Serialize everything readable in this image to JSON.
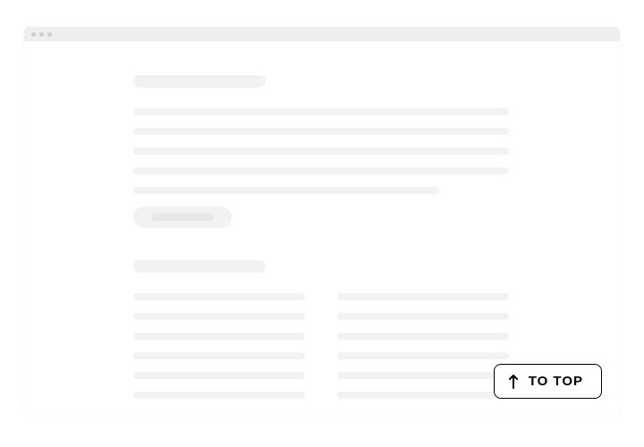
{
  "to_top_button": {
    "label": "TO TOP",
    "icon": "arrow-up-icon"
  }
}
